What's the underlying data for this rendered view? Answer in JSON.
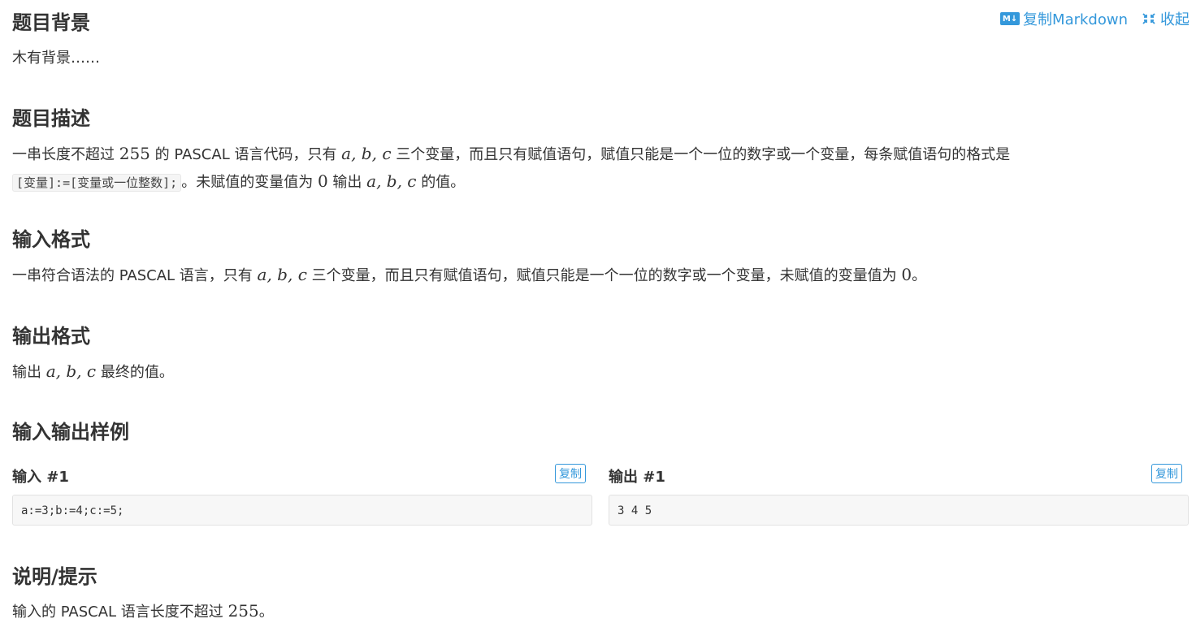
{
  "toolbar": {
    "md_badge": "M↓",
    "copy_markdown": "复制Markdown",
    "collapse": "收起"
  },
  "sections": {
    "background": {
      "title": "题目背景",
      "text": "木有背景……"
    },
    "description": {
      "title": "题目描述",
      "line1_a": "一串长度不超过 ",
      "line1_num": "255",
      "line1_b": " 的 PASCAL 语言代码，只有 ",
      "line1_vars": "a, b, c",
      "line1_c": " 三个变量，而且只有赋值语句，赋值只能是一个一位的数字或一个变量，每条赋值语句的格式是",
      "line2_code": "[变量]:=[变量或一位整数];",
      "line2_a": "。未赋值的变量值为 ",
      "line2_num": "0",
      "line2_b": " 输出 ",
      "line2_vars": "a, b, c",
      "line2_c": " 的值。"
    },
    "input_format": {
      "title": "输入格式",
      "text_a": "一串符合语法的 PASCAL 语言，只有 ",
      "text_vars": "a, b, c",
      "text_b": " 三个变量，而且只有赋值语句，赋值只能是一个一位的数字或一个变量，未赋值的变量值为 ",
      "text_num": "0",
      "text_c": "。"
    },
    "output_format": {
      "title": "输出格式",
      "text_a": "输出 ",
      "text_vars": "a, b, c",
      "text_b": " 最终的值。"
    },
    "samples": {
      "title": "输入输出样例",
      "input_label": "输入 #1",
      "output_label": "输出 #1",
      "copy_label": "复制",
      "input_value": "a:=3;b:=4;c:=5;",
      "output_value": "3 4 5"
    },
    "hint": {
      "title": "说明/提示",
      "text_a": "输入的 PASCAL 语言长度不超过 ",
      "text_num": "255",
      "text_b": "。"
    }
  }
}
